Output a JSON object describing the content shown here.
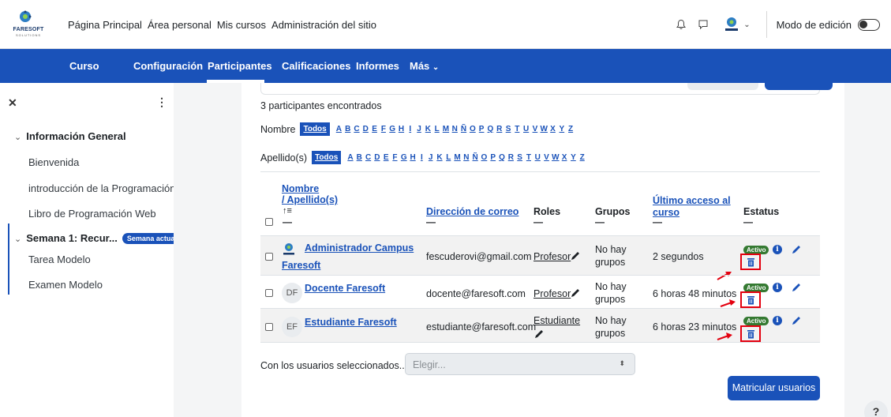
{
  "brand": {
    "name": "FARESOFT",
    "tagline": "SOLUTIONS"
  },
  "topnav": {
    "items": [
      "Página Principal",
      "Área personal",
      "Mis cursos",
      "Administración del sitio"
    ],
    "edit_mode_label": "Modo de edición"
  },
  "secnav": {
    "items": [
      "Curso",
      "Configuración",
      "Participantes",
      "Calificaciones",
      "Informes",
      "Más"
    ],
    "active": "Participantes"
  },
  "drawer": {
    "section_title": "Información General",
    "section_items": [
      "Bienvenida",
      "introducción de la Programación...",
      "Libro de Programación Web"
    ],
    "week_title": "Semana 1: Recur...",
    "week_badge": "Semana actual",
    "week_items": [
      "Tarea Modelo",
      "Examen Modelo"
    ]
  },
  "main": {
    "found_text": "3 participantes encontrados",
    "first_name_label": "Nombre",
    "last_name_label": "Apellido(s)",
    "all_label": "Todos",
    "letters": [
      "A",
      "B",
      "C",
      "D",
      "E",
      "F",
      "G",
      "H",
      "I",
      "J",
      "K",
      "L",
      "M",
      "N",
      "Ñ",
      "O",
      "P",
      "Q",
      "R",
      "S",
      "T",
      "U",
      "V",
      "W",
      "X",
      "Y",
      "Z"
    ]
  },
  "table": {
    "headers": {
      "name": "Nombre",
      "surname": "/ Apellido(s)",
      "sort_icon": "↑≡",
      "email": "Dirección de correo",
      "roles": "Roles",
      "groups": "Grupos",
      "last_access_1": "Último acceso al",
      "last_access_2": "curso",
      "status": "Estatus"
    },
    "rows": [
      {
        "initials": "",
        "name_1": "Administrador Campus",
        "name_2": "Faresoft",
        "email": "fescuderovi@gmail.com",
        "role_1": "Profesor",
        "role_2": "",
        "groups_1": "No hay",
        "groups_2": "grupos",
        "last_access": "2 segundos",
        "status": "Activo"
      },
      {
        "initials": "DF",
        "name_1": "Docente Faresoft",
        "name_2": "",
        "email": "docente@faresoft.com",
        "role_1": "Profesor",
        "role_2": "",
        "groups_1": "No hay",
        "groups_2": "grupos",
        "last_access": "6 horas 48 minutos",
        "status": "Activo"
      },
      {
        "initials": "EF",
        "name_1": "Estudiante Faresoft",
        "name_2": "",
        "email": "estudiante@faresoft.com",
        "role_1": "Estudiante",
        "role_2": "",
        "groups_1": "No hay",
        "groups_2": "grupos",
        "last_access": "6 horas 23 minutos",
        "status": "Activo"
      }
    ]
  },
  "bulk": {
    "label": "Con los usuarios seleccionados...",
    "placeholder": "Elegir..."
  },
  "enrol_button": "Matricular usuarios",
  "help": "?",
  "colors": {
    "primary": "#1a52b9",
    "active_badge": "#357a32",
    "highlight": "#e3000f"
  }
}
